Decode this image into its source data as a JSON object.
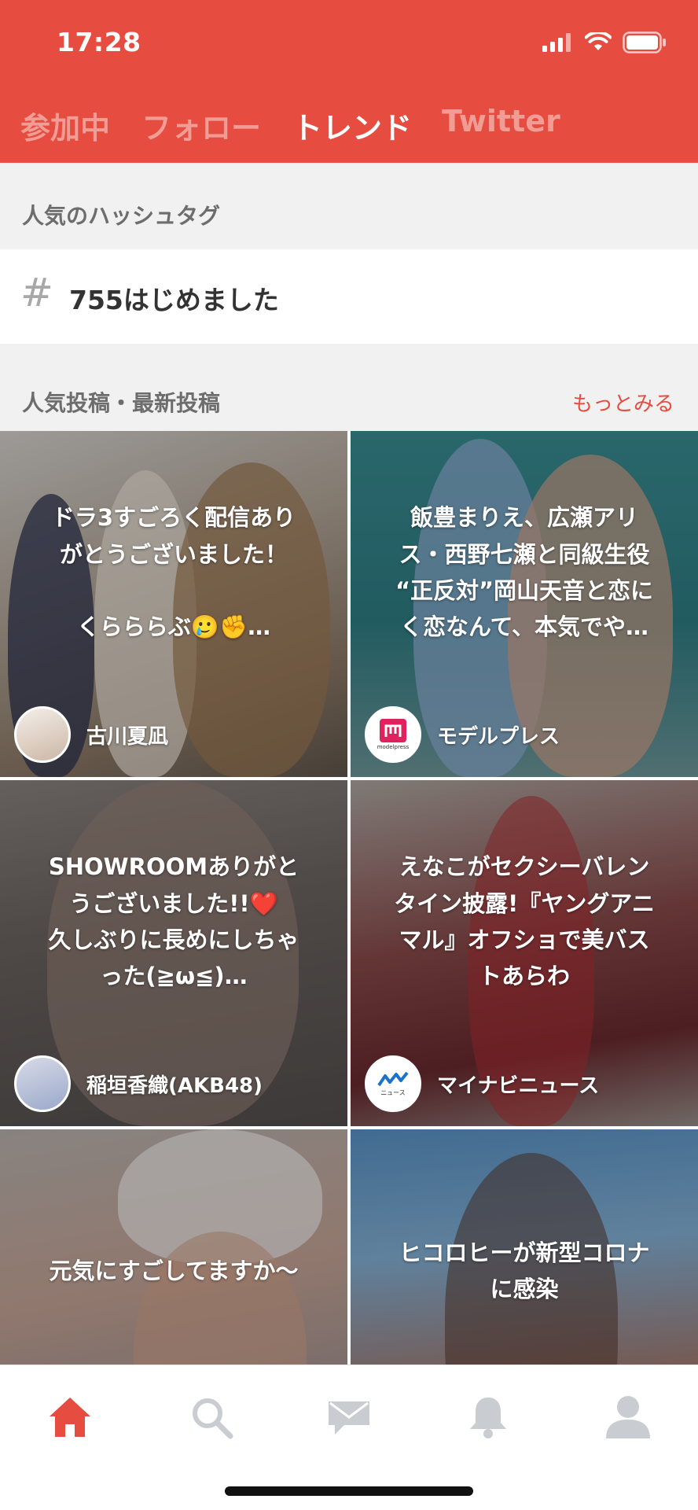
{
  "status_bar": {
    "time": "17:28"
  },
  "tabs": [
    {
      "label": "参加中",
      "active": false
    },
    {
      "label": "フォロー",
      "active": false
    },
    {
      "label": "トレンド",
      "active": true
    },
    {
      "label": "Twitter",
      "active": false
    }
  ],
  "hashtags": {
    "title": "人気のハッシュタグ",
    "items": [
      {
        "tag": "755はじめました"
      }
    ]
  },
  "posts": {
    "title": "人気投稿・最新投稿",
    "more_label": "もっとみる",
    "items": [
      {
        "caption": "ドラ3すごろく配信あり\nがとうございました！\n\nくらららぶ🥲✊…",
        "author": "古川夏凪"
      },
      {
        "caption": "飯豊まりえ、広瀬アリ\nス・西野七瀬と同級生役\n“正反対”岡山天音と恋に\nく恋なんて、本気でや…",
        "author": "モデルプレス",
        "avatar_text": "modelpress"
      },
      {
        "caption": "SHOWROOMありがと\nうございました!!❤️\n久しぶりに長めにしちゃ\nった(≧ω≦)…",
        "author": "稲垣香織(AKB48)"
      },
      {
        "caption": "えなこがセクシーバレン\nタイン披露!『ヤングアニ\nマル』オフショで美バス\nトあらわ",
        "author": "マイナビニュース",
        "avatar_text": "ニュース"
      },
      {
        "caption": "元気にすごしてますか〜",
        "author": ""
      },
      {
        "caption": "ヒコロヒーが新型コロナ\nに感染",
        "author": ""
      }
    ]
  },
  "bottom_nav": [
    {
      "icon": "home-icon",
      "active": true
    },
    {
      "icon": "search-icon",
      "active": false
    },
    {
      "icon": "mail-icon",
      "active": false
    },
    {
      "icon": "bell-icon",
      "active": false
    },
    {
      "icon": "profile-icon",
      "active": false
    }
  ],
  "colors": {
    "accent": "#e64c3f",
    "inactive_icon": "#c9ccd1",
    "section_bg": "#f1f1f1"
  }
}
